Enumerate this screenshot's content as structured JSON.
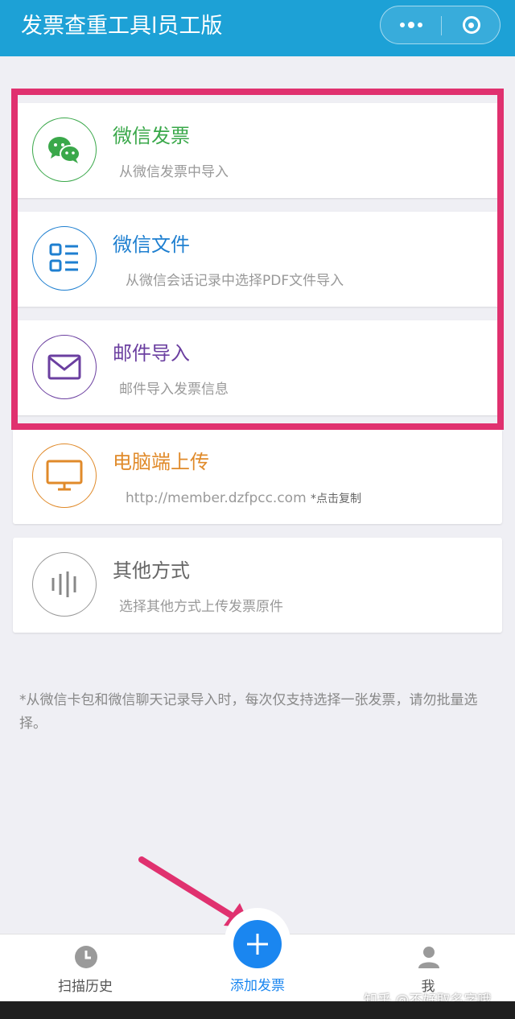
{
  "header": {
    "title": "发票查重工具l员工版",
    "more_icon": "more-icon",
    "close_icon": "close-miniprogram-icon"
  },
  "options": [
    {
      "title": "微信发票",
      "desc": "从微信发票中导入",
      "color": "#3aa84a",
      "icon": "wechat-icon"
    },
    {
      "title": "微信文件",
      "desc": "从微信会话记录中选择PDF文件导入",
      "color": "#1e7fd0",
      "icon": "file-list-icon"
    },
    {
      "title": "邮件导入",
      "desc": "邮件导入发票信息",
      "color": "#6b3fa0",
      "icon": "mail-icon"
    },
    {
      "title": "电脑端上传",
      "desc": "http://member.dzfpcc.com",
      "copy_hint": "*点击复制",
      "color": "#e08a2a",
      "icon": "monitor-icon"
    },
    {
      "title": "其他方式",
      "desc": "选择其他方式上传发票原件",
      "color": "#888888",
      "icon": "bars-icon"
    }
  ],
  "note": "*从微信卡包和微信聊天记录导入时，每次仅支持选择一张发票，请勿批量选择。",
  "tabs": {
    "history": "扫描历史",
    "add": "添加发票",
    "me": "我"
  },
  "watermark": "知乎 @不好取名字哦",
  "annotation_color": "#e0316f"
}
